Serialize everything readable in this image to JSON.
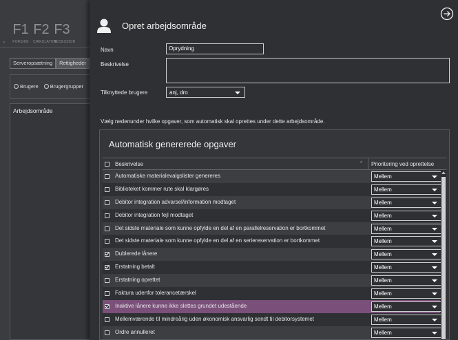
{
  "background_app": {
    "fkeys": [
      {
        "key": "F1",
        "label": "FORSIDE"
      },
      {
        "key": "F2",
        "label": "CIRKULATION"
      },
      {
        "key": "F3",
        "label": "ACCESSION"
      }
    ],
    "tabs": [
      "Serveropsætning",
      "Rettigheder"
    ],
    "radios": [
      "Brugere",
      "Brugergrupper"
    ],
    "list_item": "Arbejdsområde"
  },
  "dialog": {
    "title": "Opret arbejdsområde",
    "fields": {
      "name_label": "Navn",
      "name_value": "Oprydning",
      "description_label": "Beskrivelse",
      "description_value": "",
      "users_label": "Tilknyttede brugere",
      "users_value": "anj, dro"
    },
    "instruction": "Vælg nedenunder hvilke opgaver, som automatisk skal oprettes under dette arbejdsområde.",
    "panel": {
      "title": "Automatisk genererede opgaver",
      "columns": {
        "description": "Beskrivelse",
        "priority": "Prioritering ved oprettelse"
      },
      "rows": [
        {
          "checked": false,
          "description": "Automatiske materialevalgslister genereres",
          "priority": "Mellem"
        },
        {
          "checked": false,
          "description": "Biblioteket kommer rute skal klargøres",
          "priority": "Mellem"
        },
        {
          "checked": false,
          "description": "Debitor integration advarsel/information modtaget",
          "priority": "Mellem"
        },
        {
          "checked": false,
          "description": "Debitor integration fejl modtaget",
          "priority": "Mellem"
        },
        {
          "checked": false,
          "description": "Det sidste materiale som kunne opfylde en del af en parallelreservation er bortkommet",
          "priority": "Mellem"
        },
        {
          "checked": false,
          "description": "Det sidste materiale som kunne opfylde en del af en seriereservation er bortkommet",
          "priority": "Mellem"
        },
        {
          "checked": true,
          "description": "Dublerede lånere",
          "priority": "Mellem"
        },
        {
          "checked": true,
          "description": "Erstatning betalt",
          "priority": "Mellem"
        },
        {
          "checked": false,
          "description": "Erstatning oprettet",
          "priority": "Mellem"
        },
        {
          "checked": false,
          "description": "Faktura udenfor tolerancetærskel",
          "priority": "Mellem"
        },
        {
          "checked": true,
          "description": "Inaktive lånere kunne ikke slettes grundet udestående",
          "priority": "Mellem",
          "highlight": true
        },
        {
          "checked": false,
          "description": "Mellemværende til mindreårig uden økonomisk ansvarlig sendt til debitorsystemet",
          "priority": "Mellem"
        },
        {
          "checked": false,
          "description": "Ordre annulleret",
          "priority": "Mellem"
        }
      ]
    }
  }
}
